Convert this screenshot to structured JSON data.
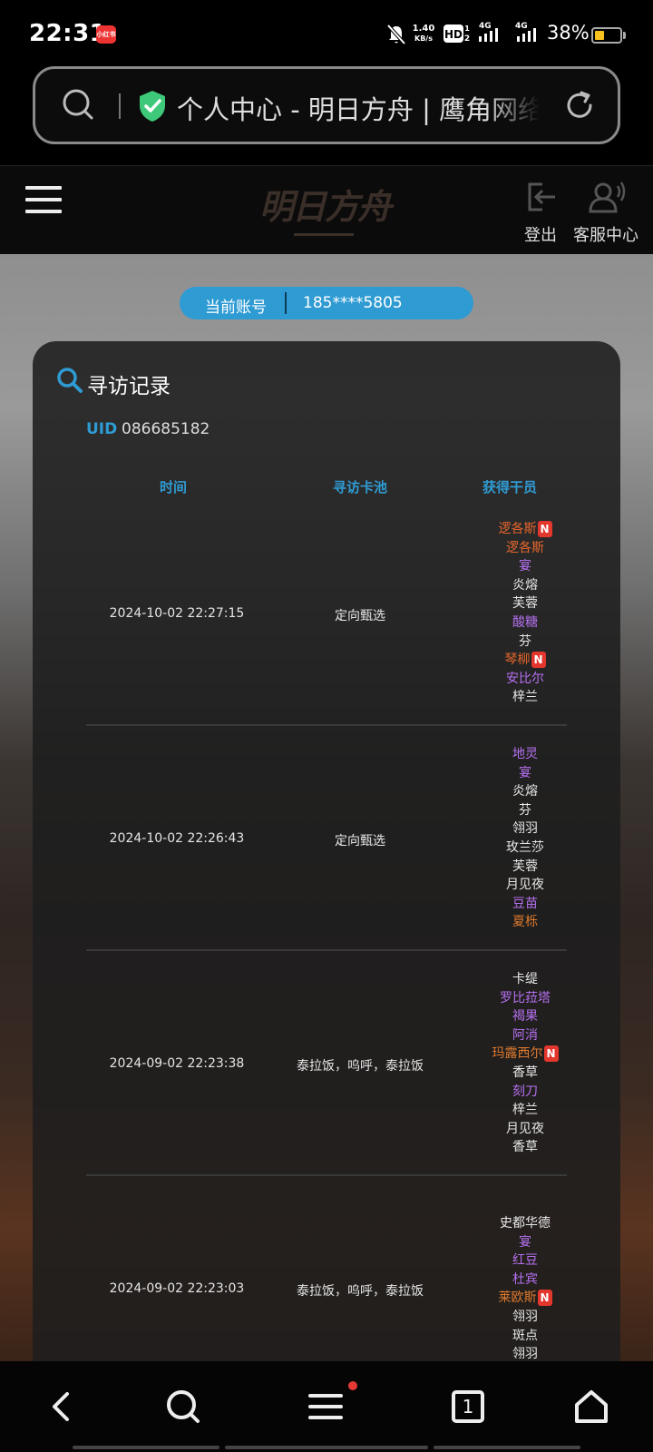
{
  "status_bar": {
    "time": "22:31",
    "net_speed_value": "1.40",
    "net_speed_unit": "KB/s",
    "signal_1": "4G",
    "signal_2": "4G",
    "battery_percent": "38%",
    "battery_level": 0.38,
    "icons": [
      "app-notification-icon",
      "bell-off-icon",
      "hd-icon",
      "signal-icon",
      "signal-icon",
      "battery-icon"
    ]
  },
  "address_bar": {
    "page_title": "个人中心 - 明日方舟 | 鹰角网络",
    "secure": true,
    "icons": [
      "search-icon",
      "shield-check-icon",
      "reload-icon"
    ]
  },
  "site_header": {
    "logo_text": "明日方舟",
    "logout_label": "登出",
    "support_label": "客服中心",
    "icons": [
      "menu-icon",
      "logout-icon",
      "support-icon"
    ]
  },
  "account": {
    "label": "当前账号",
    "value": "185****5805"
  },
  "records": {
    "title": "寻访记录",
    "uid_label": "UID",
    "uid_value": "086685182",
    "columns": {
      "time": "时间",
      "pool": "寻访卡池",
      "operators": "获得干员"
    },
    "new_badge": "N",
    "rows": [
      {
        "time": "2024-10-02 22:27:15",
        "pool": "定向甄选",
        "operators": [
          {
            "name": "逻各斯",
            "rarity": 6,
            "new": true
          },
          {
            "name": "逻各斯",
            "rarity": 6,
            "new": false
          },
          {
            "name": "宴",
            "rarity": 4,
            "new": false
          },
          {
            "name": "炎熔",
            "rarity": 3,
            "new": false
          },
          {
            "name": "芙蓉",
            "rarity": 3,
            "new": false
          },
          {
            "name": "酸糖",
            "rarity": 4,
            "new": false
          },
          {
            "name": "芬",
            "rarity": 3,
            "new": false
          },
          {
            "name": "琴柳",
            "rarity": 6,
            "new": true
          },
          {
            "name": "安比尔",
            "rarity": 4,
            "new": false
          },
          {
            "name": "梓兰",
            "rarity": 3,
            "new": false
          }
        ]
      },
      {
        "time": "2024-10-02 22:26:43",
        "pool": "定向甄选",
        "operators": [
          {
            "name": "地灵",
            "rarity": 4,
            "new": false
          },
          {
            "name": "宴",
            "rarity": 4,
            "new": false
          },
          {
            "name": "炎熔",
            "rarity": 3,
            "new": false
          },
          {
            "name": "芬",
            "rarity": 3,
            "new": false
          },
          {
            "name": "翎羽",
            "rarity": 3,
            "new": false
          },
          {
            "name": "玫兰莎",
            "rarity": 3,
            "new": false
          },
          {
            "name": "芙蓉",
            "rarity": 3,
            "new": false
          },
          {
            "name": "月见夜",
            "rarity": 3,
            "new": false
          },
          {
            "name": "豆苗",
            "rarity": 4,
            "new": false
          },
          {
            "name": "夏栎",
            "rarity": 5,
            "new": false
          }
        ]
      },
      {
        "time": "2024-09-02 22:23:38",
        "pool": "泰拉饭，呜呼，泰拉饭",
        "operators": [
          {
            "name": "卡缇",
            "rarity": 3,
            "new": false
          },
          {
            "name": "罗比菈塔",
            "rarity": 4,
            "new": false
          },
          {
            "name": "褐果",
            "rarity": 4,
            "new": false
          },
          {
            "name": "阿消",
            "rarity": 4,
            "new": false
          },
          {
            "name": "玛露西尔",
            "rarity": 5,
            "new": true
          },
          {
            "name": "香草",
            "rarity": 3,
            "new": false
          },
          {
            "name": "刻刀",
            "rarity": 4,
            "new": false
          },
          {
            "name": "梓兰",
            "rarity": 3,
            "new": false
          },
          {
            "name": "月见夜",
            "rarity": 3,
            "new": false
          },
          {
            "name": "香草",
            "rarity": 3,
            "new": false
          }
        ]
      },
      {
        "time": "2024-09-02 22:23:03",
        "pool": "泰拉饭，呜呼，泰拉饭",
        "operators": [
          {
            "name": "史都华德",
            "rarity": 3,
            "new": false
          },
          {
            "name": "宴",
            "rarity": 4,
            "new": false
          },
          {
            "name": "红豆",
            "rarity": 4,
            "new": false
          },
          {
            "name": "杜宾",
            "rarity": 4,
            "new": false
          },
          {
            "name": "莱欧斯",
            "rarity": 5,
            "new": true
          },
          {
            "name": "翎羽",
            "rarity": 3,
            "new": false
          },
          {
            "name": "斑点",
            "rarity": 3,
            "new": false
          },
          {
            "name": "翎羽",
            "rarity": 3,
            "new": false
          }
        ]
      }
    ]
  },
  "bottom_nav": {
    "tab_count": "1",
    "menu_has_dot": true,
    "icons": [
      "back-icon",
      "search-icon",
      "menu-icon",
      "tabs-icon",
      "home-icon"
    ]
  },
  "colors": {
    "accent": "#2f9bd3",
    "rarity_3": "#e8e8e8",
    "rarity_4": "#b570ef",
    "rarity_5": "#e07a2e",
    "rarity_6": "#e6662c",
    "new_badge": "#e3362d"
  }
}
